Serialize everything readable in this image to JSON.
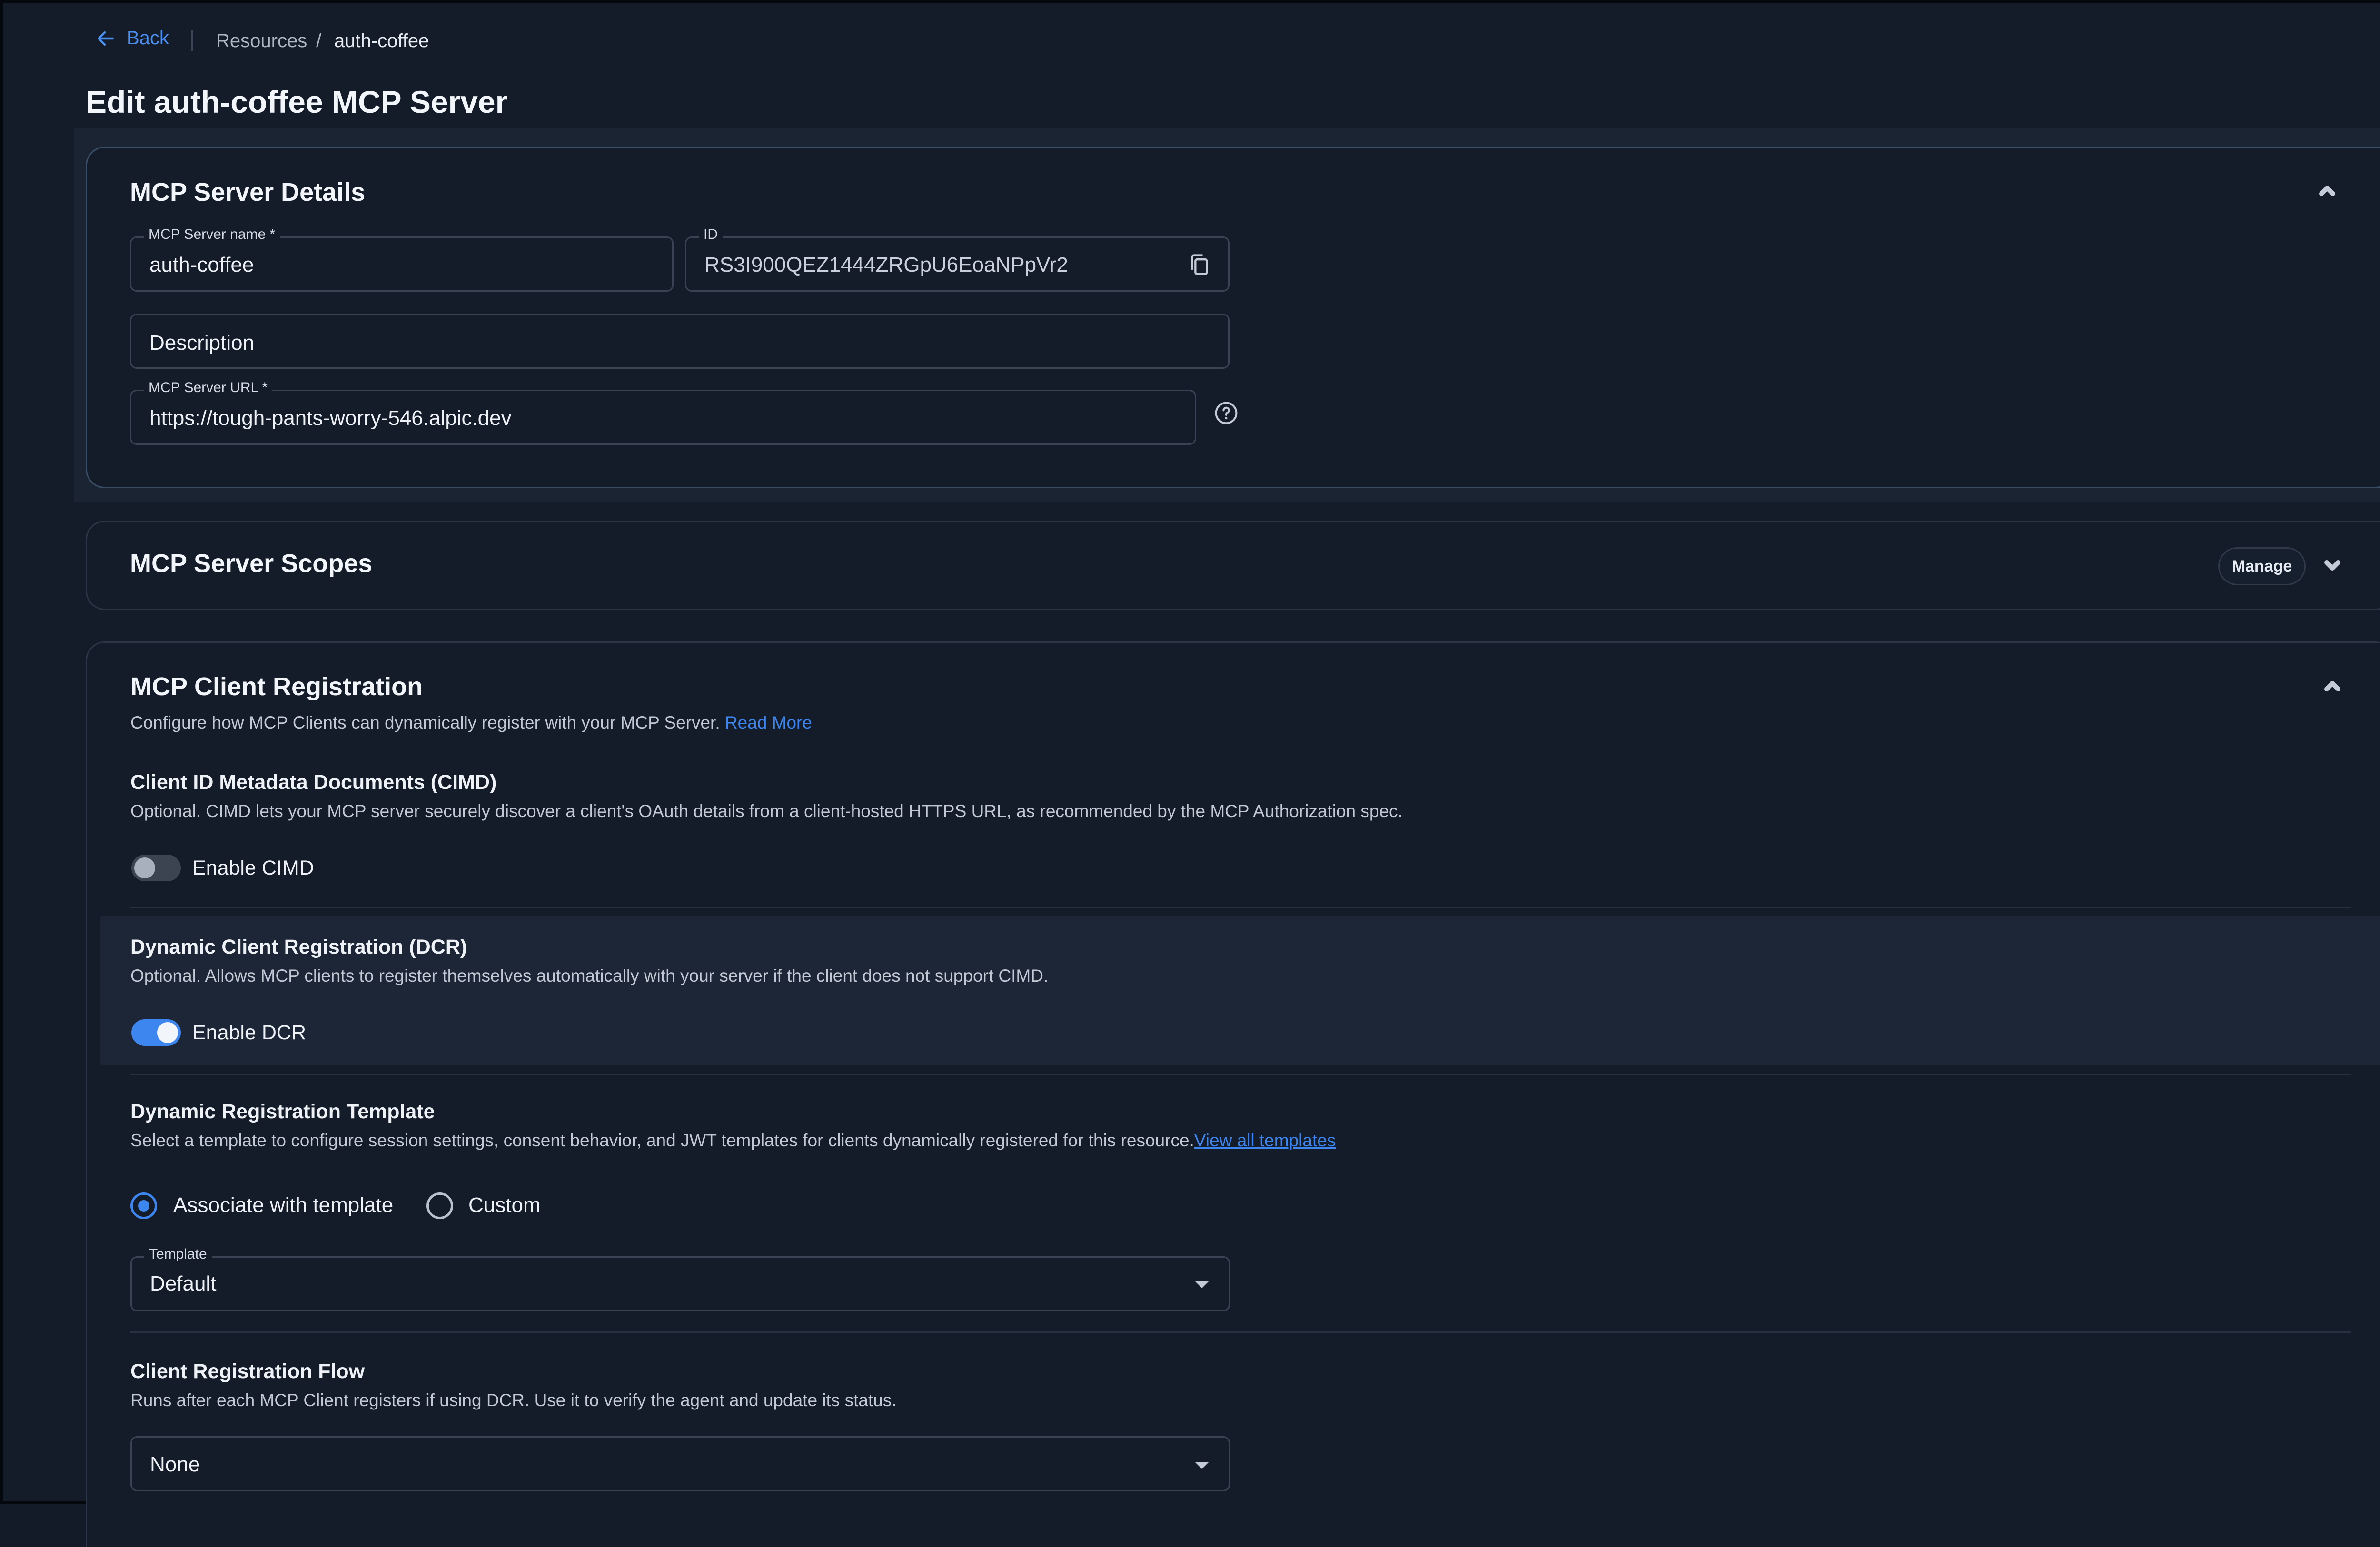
{
  "nav": {
    "back_label": "Back",
    "breadcrumb": [
      "Resources",
      "/",
      "auth-coffee"
    ]
  },
  "page": {
    "title": "Edit auth-coffee MCP Server"
  },
  "details": {
    "title": "MCP Server Details",
    "name_label": "MCP Server name *",
    "name_value": "auth-coffee",
    "id_label": "ID",
    "id_value": "RS3I900QEZ1444ZRGpU6EoaNPpVr2",
    "description_placeholder": "Description",
    "url_label": "MCP Server URL *",
    "url_value": "https://tough-pants-worry-546.alpic.dev"
  },
  "scopes": {
    "title": "MCP Server Scopes",
    "manage_label": "Manage"
  },
  "client_registration": {
    "title": "MCP Client Registration",
    "description": "Configure how MCP Clients can dynamically register with your MCP Server.",
    "read_more": "Read More",
    "cimd": {
      "title": "Client ID Metadata Documents (CIMD)",
      "description": "Optional. CIMD lets your MCP server securely discover a client's OAuth details from a client-hosted HTTPS URL, as recommended by the MCP Authorization spec.",
      "toggle_label": "Enable CIMD",
      "enabled": false
    },
    "dcr": {
      "title": "Dynamic Client Registration (DCR)",
      "description": "Optional. Allows MCP clients to register themselves automatically with your server if the client does not support CIMD.",
      "toggle_label": "Enable DCR",
      "enabled": true
    },
    "template_section": {
      "title": "Dynamic Registration Template",
      "description": "Select a template to configure session settings, consent behavior, and JWT templates for clients dynamically registered for this resource.",
      "view_all": "View all templates",
      "radio_associate": "Associate with template",
      "radio_custom": "Custom",
      "selected": "Associate with template",
      "template_label": "Template",
      "template_value": "Default"
    },
    "flow": {
      "title": "Client Registration Flow",
      "description": "Runs after each MCP Client registers if using DCR. Use it to verify the agent and update its status.",
      "value": "None"
    }
  },
  "colors": {
    "background": "#141c29",
    "accent": "#3d86ef",
    "card_border": "#2b3545"
  }
}
